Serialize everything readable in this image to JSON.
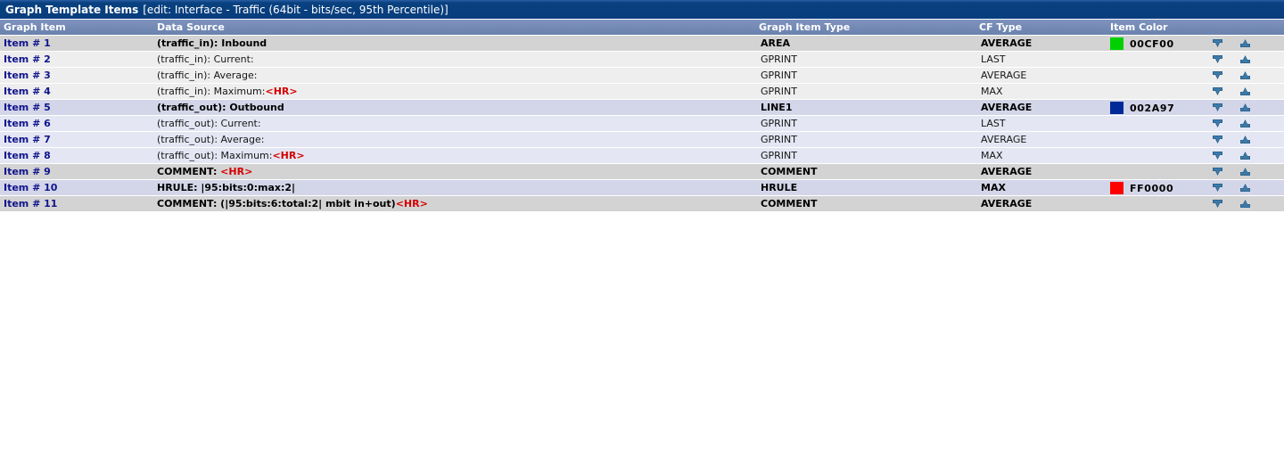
{
  "window": {
    "title_main": "Graph Template Items",
    "title_detail": "[edit: Interface - Traffic (64bit - bits/sec, 95th Percentile)]"
  },
  "table": {
    "columns": {
      "graph_item": "Graph Item",
      "data_source": "Data Source",
      "graph_item_type": "Graph Item Type",
      "cf_type": "CF Type",
      "item_color": "Item Color"
    },
    "row_controls": {
      "move_down": "move-down-arrow",
      "move_up": "move-up-arrow"
    },
    "rows": [
      {
        "item": "Item # 1",
        "data_source_prefix": "(traffic_in): Inbound",
        "data_source_tag": "",
        "graph_item_type": "AREA",
        "cf_type": "AVERAGE",
        "color_hex": "00CF00",
        "color_swatch": "#00cf00",
        "bold": true,
        "shade": "shade-a"
      },
      {
        "item": "Item # 2",
        "data_source_prefix": "(traffic_in): Current:",
        "data_source_tag": "",
        "graph_item_type": "GPRINT",
        "cf_type": "LAST",
        "color_hex": "",
        "color_swatch": "",
        "bold": false,
        "shade": "shade-b"
      },
      {
        "item": "Item # 3",
        "data_source_prefix": "(traffic_in): Average:",
        "data_source_tag": "",
        "graph_item_type": "GPRINT",
        "cf_type": "AVERAGE",
        "color_hex": "",
        "color_swatch": "",
        "bold": false,
        "shade": "shade-b"
      },
      {
        "item": "Item # 4",
        "data_source_prefix": "(traffic_in): Maximum:",
        "data_source_tag": "<HR>",
        "graph_item_type": "GPRINT",
        "cf_type": "MAX",
        "color_hex": "",
        "color_swatch": "",
        "bold": false,
        "shade": "shade-b"
      },
      {
        "item": "Item # 5",
        "data_source_prefix": "(traffic_out): Outbound",
        "data_source_tag": "",
        "graph_item_type": "LINE1",
        "cf_type": "AVERAGE",
        "color_hex": "002A97",
        "color_swatch": "#002a97",
        "bold": true,
        "shade": "shade-c"
      },
      {
        "item": "Item # 6",
        "data_source_prefix": "(traffic_out): Current:",
        "data_source_tag": "",
        "graph_item_type": "GPRINT",
        "cf_type": "LAST",
        "color_hex": "",
        "color_swatch": "",
        "bold": false,
        "shade": "shade-d"
      },
      {
        "item": "Item # 7",
        "data_source_prefix": "(traffic_out): Average:",
        "data_source_tag": "",
        "graph_item_type": "GPRINT",
        "cf_type": "AVERAGE",
        "color_hex": "",
        "color_swatch": "",
        "bold": false,
        "shade": "shade-d"
      },
      {
        "item": "Item # 8",
        "data_source_prefix": "(traffic_out): Maximum:",
        "data_source_tag": "<HR>",
        "graph_item_type": "GPRINT",
        "cf_type": "MAX",
        "color_hex": "",
        "color_swatch": "",
        "bold": false,
        "shade": "shade-d"
      },
      {
        "item": "Item # 9",
        "data_source_prefix": "COMMENT: ",
        "data_source_tag": "<HR>",
        "graph_item_type": "COMMENT",
        "cf_type": "AVERAGE",
        "color_hex": "",
        "color_swatch": "",
        "bold": true,
        "shade": "shade-a"
      },
      {
        "item": "Item # 10",
        "data_source_prefix": "HRULE: |95:bits:0:max:2|",
        "data_source_tag": "",
        "graph_item_type": "HRULE",
        "cf_type": "MAX",
        "color_hex": "FF0000",
        "color_swatch": "#ff0000",
        "bold": true,
        "shade": "shade-c"
      },
      {
        "item": "Item # 11",
        "data_source_prefix": "COMMENT: (|95:bits:6:total:2| mbit in+out)",
        "data_source_tag": "<HR>",
        "graph_item_type": "COMMENT",
        "cf_type": "AVERAGE",
        "color_hex": "",
        "color_swatch": "",
        "bold": true,
        "shade": "shade-a"
      }
    ]
  },
  "theme": {
    "title_bar_color": "#073d7d",
    "header_row_color": "#6b82ae",
    "link_color": "#10148c",
    "tag_color": "#d40000",
    "arrow_color": "#2e6490"
  }
}
